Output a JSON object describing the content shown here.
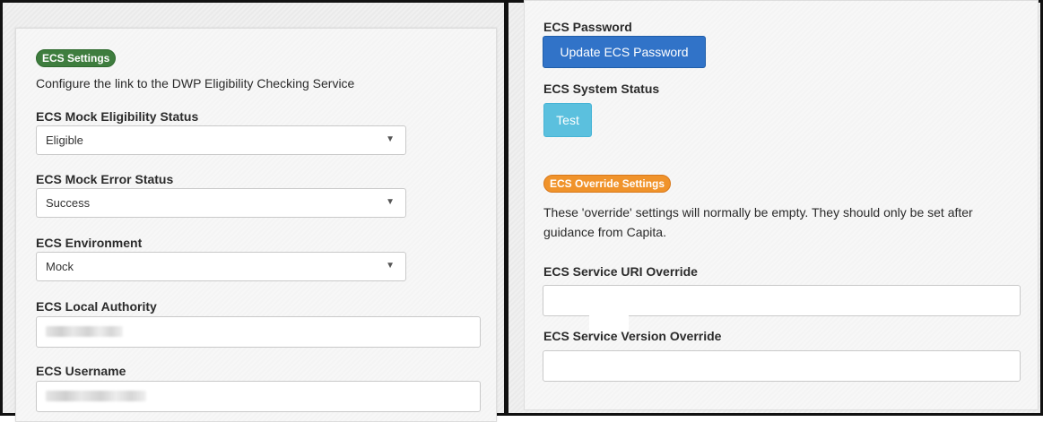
{
  "left": {
    "badge": "ECS Settings",
    "description": "Configure the link to the DWP Eligibility Checking Service",
    "mock_eligibility": {
      "label": "ECS Mock Eligibility Status",
      "value": "Eligible"
    },
    "mock_error": {
      "label": "ECS Mock Error Status",
      "value": "Success"
    },
    "environment": {
      "label": "ECS Environment",
      "value": "Mock"
    },
    "local_authority": {
      "label": "ECS Local Authority"
    },
    "username": {
      "label": "ECS Username"
    }
  },
  "right": {
    "password": {
      "label": "ECS Password",
      "button": "Update ECS Password"
    },
    "system_status": {
      "label": "ECS System Status",
      "button": "Test"
    },
    "override": {
      "badge": "ECS Override Settings",
      "description_line1": "These 'override' settings will normally be empty. They should only be set after",
      "description_line2": "guidance from Capita.",
      "uri": {
        "label": "ECS Service URI Override",
        "value": ""
      },
      "version": {
        "label": "ECS Service Version Override",
        "value": ""
      }
    }
  },
  "icons": {
    "caret": "caret-down-icon"
  },
  "colors": {
    "green_badge": "#3e7d3e",
    "orange_badge": "#f0932b",
    "primary": "#3173c8",
    "info": "#5bc0de"
  }
}
